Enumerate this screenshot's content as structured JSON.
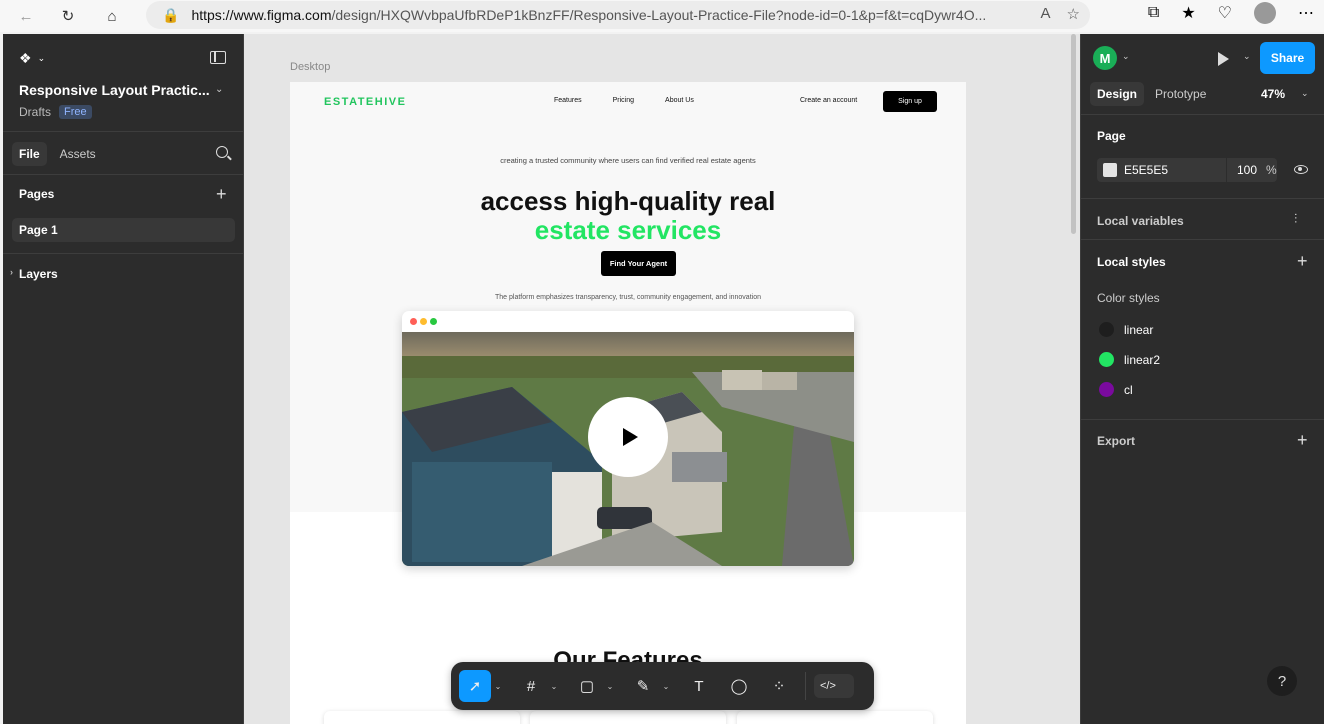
{
  "browser": {
    "url_host": "https://www.figma.com",
    "url_path": "/design/HXQWvbpaUfbRDeP1kBnzFF/Responsive-Layout-Practice-File?node-id=0-1&p=f&t=cqDywr4O..."
  },
  "left_panel": {
    "file_name": "Responsive Layout Practic...",
    "location": "Drafts",
    "plan_badge": "Free",
    "tabs": [
      "File",
      "Assets"
    ],
    "pages_header": "Pages",
    "pages": [
      "Page 1"
    ],
    "layers_header": "Layers"
  },
  "right_panel": {
    "user_initial": "M",
    "share_label": "Share",
    "tabs": [
      "Design",
      "Prototype"
    ],
    "zoom": "47%",
    "page_header": "Page",
    "page_fill_hex": "E5E5E5",
    "page_fill_opacity": "100",
    "page_fill_unit": "%",
    "local_variables": "Local variables",
    "local_styles": "Local styles",
    "color_styles_header": "Color styles",
    "color_styles": [
      {
        "name": "linear",
        "color": "#1e1e1e"
      },
      {
        "name": "linear2",
        "color": "#22e563"
      },
      {
        "name": "cl",
        "color": "#7a0a9e"
      }
    ],
    "export": "Export",
    "help": "?"
  },
  "canvas": {
    "frame_label": "Desktop",
    "site": {
      "brand": "ESTATEHIVE",
      "nav": [
        "Features",
        "Pricing",
        "About Us"
      ],
      "create_account": "Create an account",
      "signup": "Sign up",
      "tagline": "creating a trusted community where users can find verified real estate agents",
      "headline_1": "access high-quality real",
      "headline_2": "estate services",
      "cta": "Find Your Agent",
      "emphasis": "The platform emphasizes transparency, trust, community engagement, and innovation",
      "features_heading": "Our Features"
    }
  },
  "colors": {
    "accent": "#0d99ff",
    "brand_green": "#22c55e",
    "headline_green": "#22e563"
  }
}
